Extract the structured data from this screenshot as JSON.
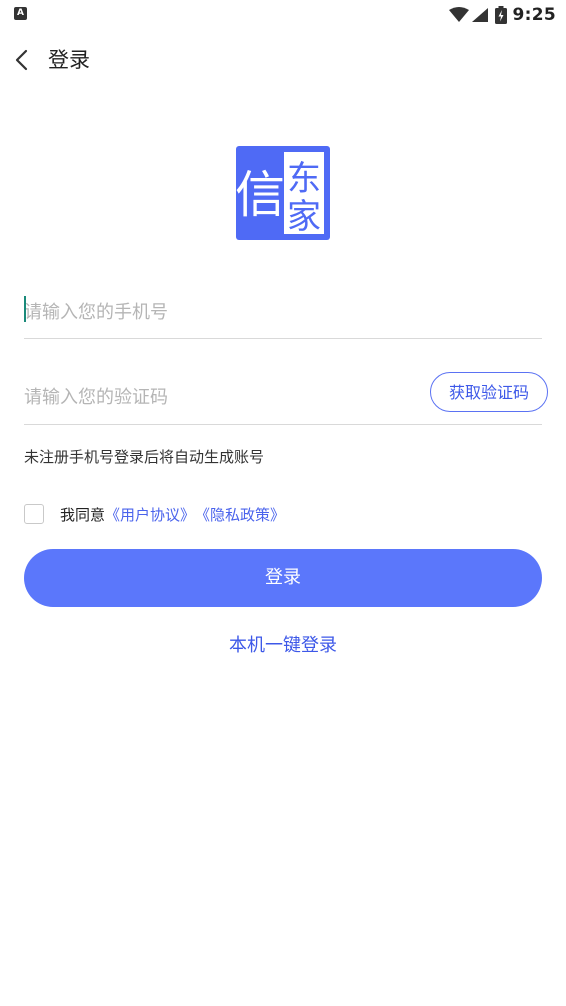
{
  "status_bar": {
    "left_icon_label": "A",
    "time": "9:25",
    "icons": [
      "wifi-icon",
      "signal-icon",
      "battery-icon"
    ]
  },
  "header": {
    "title": "登录",
    "back_icon": "chevron-left-icon"
  },
  "logo": {
    "char_left": "信",
    "char_top": "东",
    "char_bottom": "家",
    "color": "#4f6af5"
  },
  "form": {
    "phone_placeholder": "请输入您的手机号",
    "phone_value": "",
    "code_placeholder": "请输入您的验证码",
    "code_value": "",
    "get_code_label": "获取验证码",
    "hint": "未注册手机号登录后将自动生成账号"
  },
  "agreement": {
    "checked": false,
    "prefix": "我同意",
    "user_agreement": "《用户协议》",
    "privacy_policy": "《隐私政策》"
  },
  "login_button_label": "登录",
  "quick_login_label": "本机一键登录",
  "colors": {
    "accent": "#5b77fb",
    "link": "#3d58e8"
  }
}
